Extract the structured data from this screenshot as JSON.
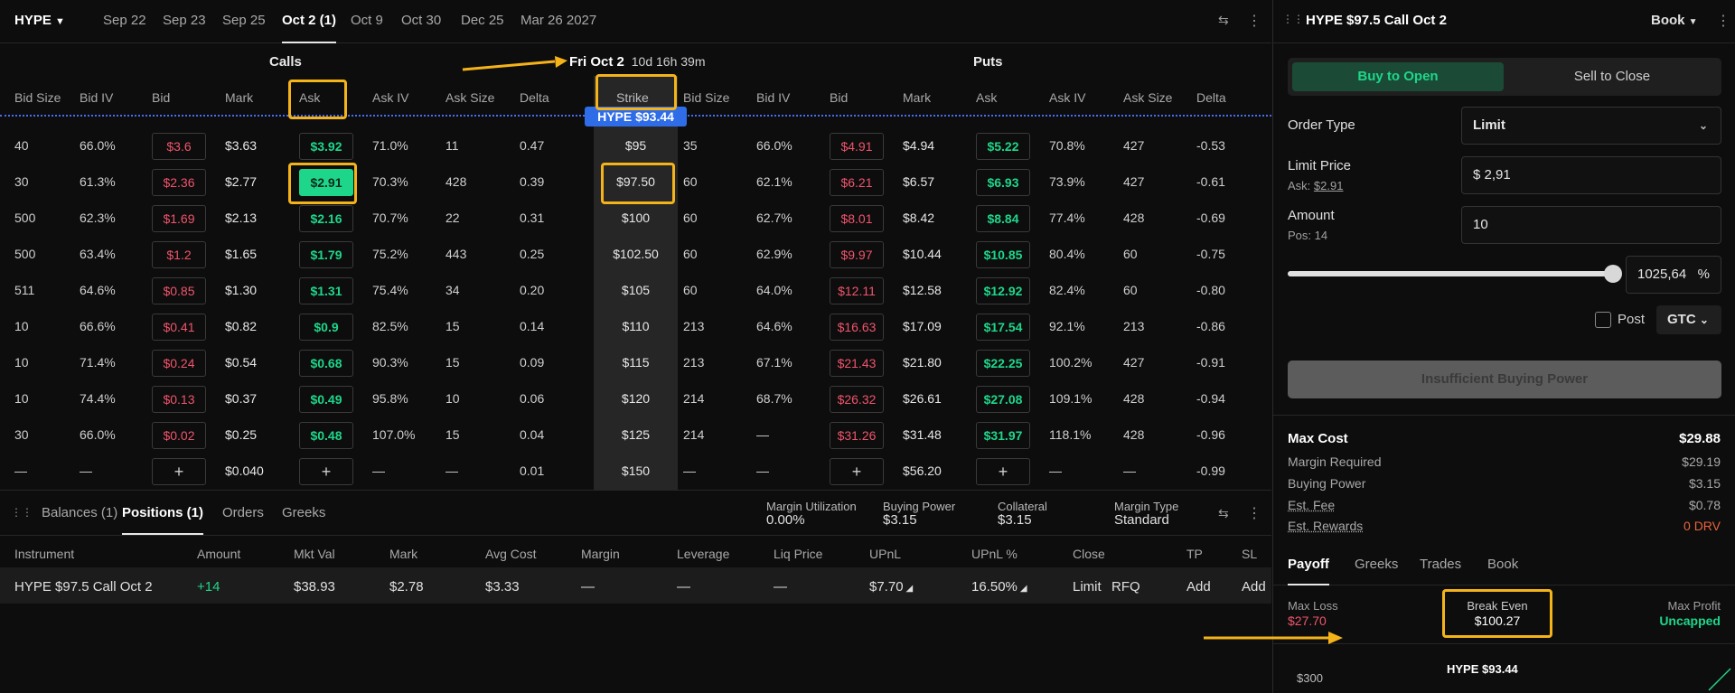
{
  "topbar": {
    "asset": "HYPE",
    "expiries": [
      "Sep 22",
      "Sep 23",
      "Sep 25",
      "Oct 2 (1)",
      "Oct 9",
      "Oct 30",
      "Dec 25",
      "Mar 26 2027"
    ],
    "active_expiry": "Oct 2 (1)"
  },
  "chain": {
    "calls_title": "Calls",
    "puts_title": "Puts",
    "expiry_label": "Fri Oct 2",
    "countdown": "10d 16h 39m",
    "underlying_badge": "HYPE $93.44",
    "call_headers": [
      "Bid Size",
      "Bid IV",
      "Bid",
      "Mark",
      "Ask",
      "Ask IV",
      "Ask Size",
      "Delta"
    ],
    "strike_header": "Strike",
    "put_headers": [
      "Bid Size",
      "Bid IV",
      "Bid",
      "Mark",
      "Ask",
      "Ask IV",
      "Ask Size",
      "Delta"
    ],
    "rows": [
      {
        "strike": "$95",
        "c_bid_size": "40",
        "c_bid_iv": "66.0%",
        "c_bid": "$3.6",
        "c_mark": "$3.63",
        "c_ask": "$3.92",
        "c_ask_iv": "71.0%",
        "c_ask_size": "11",
        "c_delta": "0.47",
        "p_bid_size": "35",
        "p_bid_iv": "66.0%",
        "p_bid": "$4.91",
        "p_mark": "$4.94",
        "p_ask": "$5.22",
        "p_ask_iv": "70.8%",
        "p_ask_size": "427",
        "p_delta": "-0.53"
      },
      {
        "strike": "$97.50",
        "c_bid_size": "30",
        "c_bid_iv": "61.3%",
        "c_bid": "$2.36",
        "c_mark": "$2.77",
        "c_ask": "$2.91",
        "c_ask_iv": "70.3%",
        "c_ask_size": "428",
        "c_delta": "0.39",
        "p_bid_size": "60",
        "p_bid_iv": "62.1%",
        "p_bid": "$6.21",
        "p_mark": "$6.57",
        "p_ask": "$6.93",
        "p_ask_iv": "73.9%",
        "p_ask_size": "427",
        "p_delta": "-0.61"
      },
      {
        "strike": "$100",
        "c_bid_size": "500",
        "c_bid_iv": "62.3%",
        "c_bid": "$1.69",
        "c_mark": "$2.13",
        "c_ask": "$2.16",
        "c_ask_iv": "70.7%",
        "c_ask_size": "22",
        "c_delta": "0.31",
        "p_bid_size": "60",
        "p_bid_iv": "62.7%",
        "p_bid": "$8.01",
        "p_mark": "$8.42",
        "p_ask": "$8.84",
        "p_ask_iv": "77.4%",
        "p_ask_size": "428",
        "p_delta": "-0.69"
      },
      {
        "strike": "$102.50",
        "c_bid_size": "500",
        "c_bid_iv": "63.4%",
        "c_bid": "$1.2",
        "c_mark": "$1.65",
        "c_ask": "$1.79",
        "c_ask_iv": "75.2%",
        "c_ask_size": "443",
        "c_delta": "0.25",
        "p_bid_size": "60",
        "p_bid_iv": "62.9%",
        "p_bid": "$9.97",
        "p_mark": "$10.44",
        "p_ask": "$10.85",
        "p_ask_iv": "80.4%",
        "p_ask_size": "60",
        "p_delta": "-0.75"
      },
      {
        "strike": "$105",
        "c_bid_size": "511",
        "c_bid_iv": "64.6%",
        "c_bid": "$0.85",
        "c_mark": "$1.30",
        "c_ask": "$1.31",
        "c_ask_iv": "75.4%",
        "c_ask_size": "34",
        "c_delta": "0.20",
        "p_bid_size": "60",
        "p_bid_iv": "64.0%",
        "p_bid": "$12.11",
        "p_mark": "$12.58",
        "p_ask": "$12.92",
        "p_ask_iv": "82.4%",
        "p_ask_size": "60",
        "p_delta": "-0.80"
      },
      {
        "strike": "$110",
        "c_bid_size": "10",
        "c_bid_iv": "66.6%",
        "c_bid": "$0.41",
        "c_mark": "$0.82",
        "c_ask": "$0.9",
        "c_ask_iv": "82.5%",
        "c_ask_size": "15",
        "c_delta": "0.14",
        "p_bid_size": "213",
        "p_bid_iv": "64.6%",
        "p_bid": "$16.63",
        "p_mark": "$17.09",
        "p_ask": "$17.54",
        "p_ask_iv": "92.1%",
        "p_ask_size": "213",
        "p_delta": "-0.86"
      },
      {
        "strike": "$115",
        "c_bid_size": "10",
        "c_bid_iv": "71.4%",
        "c_bid": "$0.24",
        "c_mark": "$0.54",
        "c_ask": "$0.68",
        "c_ask_iv": "90.3%",
        "c_ask_size": "15",
        "c_delta": "0.09",
        "p_bid_size": "213",
        "p_bid_iv": "67.1%",
        "p_bid": "$21.43",
        "p_mark": "$21.80",
        "p_ask": "$22.25",
        "p_ask_iv": "100.2%",
        "p_ask_size": "427",
        "p_delta": "-0.91"
      },
      {
        "strike": "$120",
        "c_bid_size": "10",
        "c_bid_iv": "74.4%",
        "c_bid": "$0.13",
        "c_mark": "$0.37",
        "c_ask": "$0.49",
        "c_ask_iv": "95.8%",
        "c_ask_size": "10",
        "c_delta": "0.06",
        "p_bid_size": "214",
        "p_bid_iv": "68.7%",
        "p_bid": "$26.32",
        "p_mark": "$26.61",
        "p_ask": "$27.08",
        "p_ask_iv": "109.1%",
        "p_ask_size": "428",
        "p_delta": "-0.94"
      },
      {
        "strike": "$125",
        "c_bid_size": "30",
        "c_bid_iv": "66.0%",
        "c_bid": "$0.02",
        "c_mark": "$0.25",
        "c_ask": "$0.48",
        "c_ask_iv": "107.0%",
        "c_ask_size": "15",
        "c_delta": "0.04",
        "p_bid_size": "214",
        "p_bid_iv": "—",
        "p_bid": "$31.26",
        "p_mark": "$31.48",
        "p_ask": "$31.97",
        "p_ask_iv": "118.1%",
        "p_ask_size": "428",
        "p_delta": "-0.96"
      },
      {
        "strike": "$150",
        "c_bid_size": "—",
        "c_bid_iv": "—",
        "c_bid": "+",
        "c_mark": "$0.040",
        "c_ask": "+",
        "c_ask_iv": "—",
        "c_ask_size": "—",
        "c_delta": "0.01",
        "p_bid_size": "—",
        "p_bid_iv": "—",
        "p_bid": "+",
        "p_mark": "$56.20",
        "p_ask": "+",
        "p_ask_iv": "—",
        "p_ask_size": "—",
        "p_delta": "-0.99"
      }
    ]
  },
  "bottom": {
    "tabs": [
      "Balances (1)",
      "Positions (1)",
      "Orders",
      "Greeks"
    ],
    "active_tab": "Positions (1)",
    "stats": [
      {
        "label": "Margin Utilization",
        "value": "0.00%"
      },
      {
        "label": "Buying Power",
        "value": "$3.15"
      },
      {
        "label": "Collateral",
        "value": "$3.15"
      },
      {
        "label": "Margin Type",
        "value": "Standard"
      }
    ],
    "headers": [
      "Instrument",
      "Amount",
      "Mkt Val",
      "Mark",
      "Avg Cost",
      "Margin",
      "Leverage",
      "Liq Price",
      "UPnL",
      "UPnL %",
      "Close",
      "TP",
      "SL"
    ],
    "position": {
      "instrument": "HYPE $97.5 Call Oct 2",
      "amount": "+14",
      "mkt_val": "$38.93",
      "mark": "$2.78",
      "avg_cost": "$3.33",
      "margin": "—",
      "leverage": "—",
      "liq_price": "—",
      "upnl": "$7.70",
      "upnl_pct": "16.50%",
      "close_limit": "Limit",
      "close_rfq": "RFQ",
      "tp": "Add",
      "sl": "Add"
    }
  },
  "order": {
    "title": "HYPE $97.5 Call Oct 2",
    "view_select": "Book",
    "buy_label": "Buy to Open",
    "sell_label": "Sell to Close",
    "order_type_label": "Order Type",
    "order_type_value": "Limit",
    "limit_price_label": "Limit Price",
    "ask_hint_prefix": "Ask:",
    "ask_hint_value": "$2.91",
    "limit_price_value": "$ 2,91",
    "amount_label": "Amount",
    "pos_hint": "Pos: 14",
    "amount_value": "10",
    "slider_fraction": 1.0,
    "percent_value": "1025,64",
    "percent_symbol": "%",
    "post_label": "Post",
    "tif_value": "GTC",
    "submit_label": "Insufficient Buying Power",
    "max_cost_label": "Max Cost",
    "max_cost_value": "$29.88",
    "summary": [
      {
        "label": "Margin Required",
        "value": "$29.19"
      },
      {
        "label": "Buying Power",
        "value": "$3.15"
      },
      {
        "label": "Est. Fee",
        "value": "$0.78"
      },
      {
        "label": "Est. Rewards",
        "value": "0 DRV"
      }
    ],
    "tabs": [
      "Payoff",
      "Greeks",
      "Trades",
      "Book"
    ],
    "active_tab": "Payoff",
    "max_loss_label": "Max Loss",
    "max_loss_value": "$27.70",
    "break_even_label": "Break Even",
    "break_even_value": "$100.27",
    "max_profit_label": "Max Profit",
    "max_profit_value": "Uncapped",
    "chart_price_label": "$300",
    "chart_spot_label": "HYPE $93.44"
  },
  "colors": {
    "green": "#1ed68a",
    "red": "#f0546c",
    "highlight": "#f5b31a",
    "badge": "#2f6de8",
    "buy_bg": "#1b4a36"
  }
}
